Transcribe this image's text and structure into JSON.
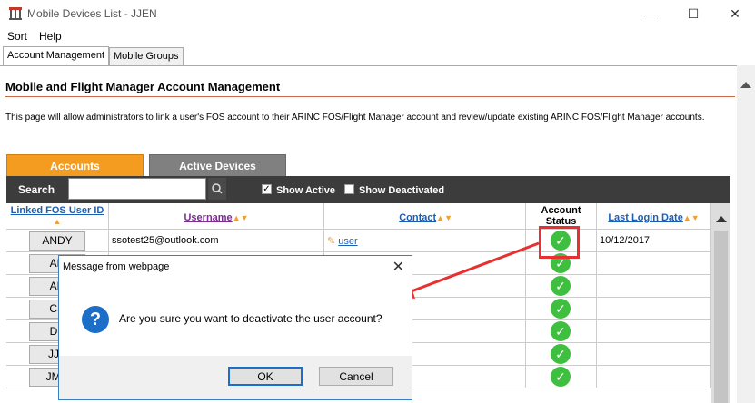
{
  "window": {
    "title": "Mobile Devices List - JJEN",
    "minimize": "—",
    "maximize": "☐",
    "close": "✕"
  },
  "menu": [
    "Sort",
    "Help"
  ],
  "tabs": [
    "Account Management",
    "Mobile Groups"
  ],
  "page": {
    "heading": "Mobile and Flight Manager Account Management",
    "description": "This page will allow administrators to link a user's FOS account to their ARINC FOS/Flight Manager account and review/update existing ARINC FOS/Flight Manager accounts."
  },
  "subtabs": {
    "accounts": "Accounts",
    "devices": "Active Devices"
  },
  "search": {
    "label": "Search",
    "value": "",
    "show_active": "Show Active",
    "show_deactivated": "Show Deactivated",
    "show_active_checked": true,
    "show_deactivated_checked": false
  },
  "columns": {
    "linked_fos_user_id": "Linked FOS User ID",
    "username": "Username",
    "contact": "Contact",
    "account_status": "Account Status",
    "last_login_date": "Last Login Date"
  },
  "rows": [
    {
      "id": "ANDY",
      "username": "ssotest25@outlook.com",
      "contact": "user",
      "last_login": "10/12/2017"
    },
    {
      "id": "AN",
      "username": "",
      "contact": "",
      "last_login": ""
    },
    {
      "id": "AR",
      "username": "",
      "contact": "",
      "last_login": ""
    },
    {
      "id": "CD",
      "username": "",
      "contact": "",
      "last_login": ""
    },
    {
      "id": "DS",
      "username": "",
      "contact": "",
      "last_login": ""
    },
    {
      "id": "JJE",
      "username": "",
      "contact": "",
      "last_login": ""
    },
    {
      "id": "JMC",
      "username": "",
      "contact": "",
      "last_login": ""
    }
  ],
  "dialog": {
    "title": "Message from webpage",
    "message": "Are you sure you want to deactivate the user account?",
    "ok": "OK",
    "cancel": "Cancel",
    "close": "✕"
  },
  "colors": {
    "accent_orange": "#f39c1f",
    "status_green": "#3fbf3f",
    "annotation_red": "#e83030"
  }
}
